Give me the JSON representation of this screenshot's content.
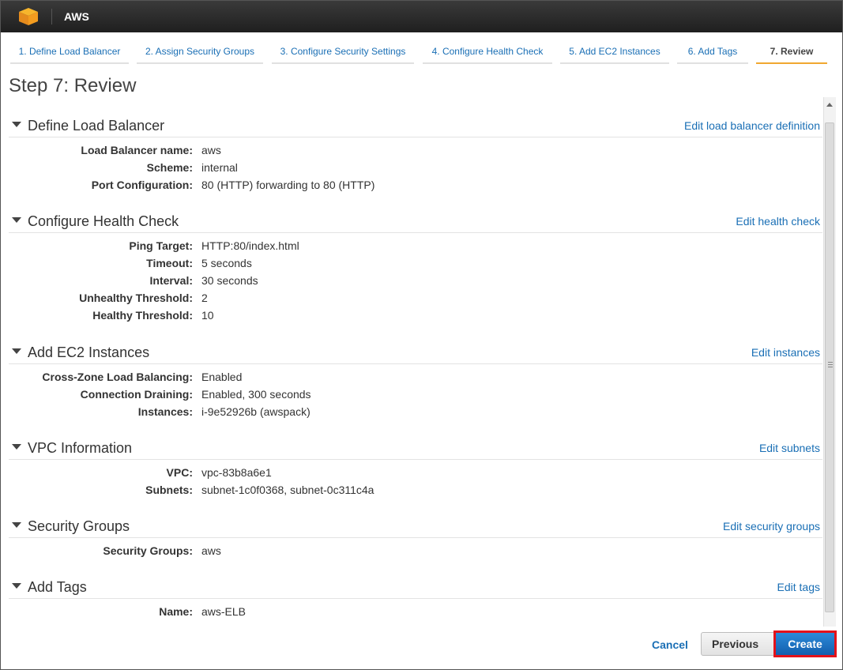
{
  "app": {
    "title": "AWS",
    "logo_icon": "aws-cube-icon",
    "accent": "#f0a830",
    "link_color": "#1a6fb5"
  },
  "tabs": [
    {
      "label": "1. Define Load Balancer",
      "active": false
    },
    {
      "label": "2. Assign Security Groups",
      "active": false
    },
    {
      "label": "3. Configure Security Settings",
      "active": false
    },
    {
      "label": "4. Configure Health Check",
      "active": false
    },
    {
      "label": "5. Add EC2 Instances",
      "active": false
    },
    {
      "label": "6. Add Tags",
      "active": false
    },
    {
      "label": "7. Review",
      "active": true
    }
  ],
  "page_title": "Step 7: Review",
  "sections": {
    "define_lb": {
      "title": "Define Load Balancer",
      "edit": "Edit load balancer definition",
      "rows": [
        {
          "label": "Load Balancer name:",
          "value": "aws"
        },
        {
          "label": "Scheme:",
          "value": "internal"
        },
        {
          "label": "Port Configuration:",
          "value": "80 (HTTP) forwarding to 80 (HTTP)"
        }
      ]
    },
    "health_check": {
      "title": "Configure Health Check",
      "edit": "Edit health check",
      "rows": [
        {
          "label": "Ping Target:",
          "value": "HTTP:80/index.html"
        },
        {
          "label": "Timeout:",
          "value": "5 seconds"
        },
        {
          "label": "Interval:",
          "value": "30 seconds"
        },
        {
          "label": "Unhealthy Threshold:",
          "value": "2"
        },
        {
          "label": "Healthy Threshold:",
          "value": "10"
        }
      ]
    },
    "ec2": {
      "title": "Add EC2 Instances",
      "edit": "Edit instances",
      "rows": [
        {
          "label": "Cross-Zone Load Balancing:",
          "value": "Enabled"
        },
        {
          "label": "Connection Draining:",
          "value": "Enabled, 300 seconds"
        },
        {
          "label": "Instances:",
          "value": "i-9e52926b (awspack)"
        }
      ]
    },
    "vpc": {
      "title": "VPC Information",
      "edit": "Edit subnets",
      "rows": [
        {
          "label": "VPC:",
          "value": "vpc-83b8a6e1"
        },
        {
          "label": "Subnets:",
          "value": "subnet-1c0f0368, subnet-0c311c4a"
        }
      ]
    },
    "security": {
      "title": "Security Groups",
      "edit": "Edit security groups",
      "rows": [
        {
          "label": "Security Groups:",
          "value": "aws"
        }
      ]
    },
    "tags": {
      "title": "Add Tags",
      "edit": "Edit tags",
      "rows": [
        {
          "label": "Name:",
          "value": "aws-ELB"
        }
      ]
    }
  },
  "footer": {
    "cancel": "Cancel",
    "previous": "Previous",
    "create": "Create"
  }
}
